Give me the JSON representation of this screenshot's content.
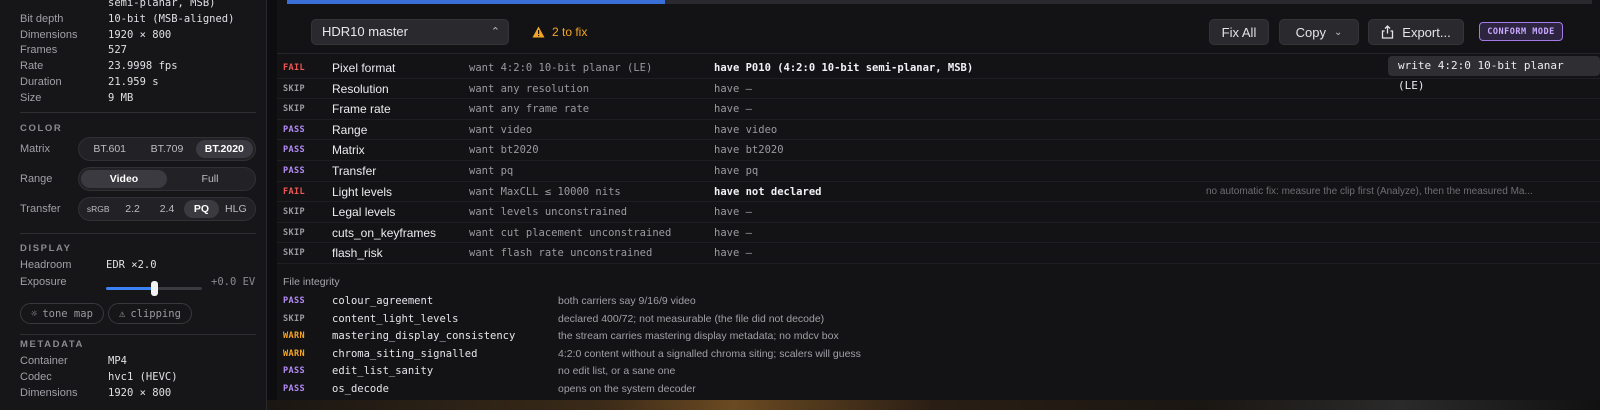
{
  "sidebar": {
    "file_info": [
      {
        "key": "",
        "value": "semi-planar, MSB)"
      },
      {
        "key": "Bit depth",
        "value": "10-bit (MSB-aligned)"
      },
      {
        "key": "Dimensions",
        "value": "1920 × 800"
      },
      {
        "key": "Frames",
        "value": "527"
      },
      {
        "key": "Rate",
        "value": "23.9998 fps"
      },
      {
        "key": "Duration",
        "value": "21.959 s"
      },
      {
        "key": "Size",
        "value": "9 MB"
      }
    ],
    "color": {
      "title": "COLOR",
      "matrix_label": "Matrix",
      "matrix_options": [
        "BT.601",
        "BT.709",
        "BT.2020"
      ],
      "matrix_selected": "BT.2020",
      "range_label": "Range",
      "range_options": [
        "Video",
        "Full"
      ],
      "range_selected": "Video",
      "transfer_label": "Transfer",
      "transfer_options": [
        "sRGB",
        "2.2",
        "2.4",
        "PQ",
        "HLG"
      ],
      "transfer_selected": "PQ"
    },
    "display": {
      "title": "DISPLAY",
      "headroom_label": "Headroom",
      "headroom_value": "EDR ×2.0",
      "exposure_label": "Exposure",
      "exposure_value": "+0.0 EV",
      "exposure_fraction": 0.5,
      "tone_map_label": "tone map",
      "clipping_label": "clipping"
    },
    "metadata": {
      "title": "METADATA",
      "items": [
        {
          "key": "Container",
          "value": "MP4"
        },
        {
          "key": "Codec",
          "value": "hvc1 (HEVC)"
        },
        {
          "key": "Dimensions",
          "value": "1920 × 800"
        }
      ]
    }
  },
  "toolbar": {
    "preset": "HDR10 master",
    "fix_count": "2 to fix",
    "fix_all": "Fix All",
    "copy": "Copy",
    "export": "Export...",
    "mode_badge": "CONFORM MODE",
    "progress_fraction": 0.29
  },
  "checks": [
    {
      "status": "FAIL",
      "name": "Pixel format",
      "want": "want 4:2:0 10-bit planar (LE)",
      "have": "have P010 (4:2:0 10-bit semi-planar, MSB)",
      "have_bold": true,
      "note": "",
      "action": "write 4:2:0 10-bit planar (LE)"
    },
    {
      "status": "SKIP",
      "name": "Resolution",
      "want": "want any resolution",
      "have": "have —",
      "have_bold": false,
      "note": "",
      "action": ""
    },
    {
      "status": "SKIP",
      "name": "Frame rate",
      "want": "want any frame rate",
      "have": "have —",
      "have_bold": false,
      "note": "",
      "action": ""
    },
    {
      "status": "PASS",
      "name": "Range",
      "want": "want video",
      "have": "have video",
      "have_bold": false,
      "note": "",
      "action": ""
    },
    {
      "status": "PASS",
      "name": "Matrix",
      "want": "want bt2020",
      "have": "have bt2020",
      "have_bold": false,
      "note": "",
      "action": ""
    },
    {
      "status": "PASS",
      "name": "Transfer",
      "want": "want pq",
      "have": "have pq",
      "have_bold": false,
      "note": "",
      "action": ""
    },
    {
      "status": "FAIL",
      "name": "Light levels",
      "want": "want MaxCLL ≤ 10000 nits",
      "have": "have not declared",
      "have_bold": true,
      "note": "no automatic fix: measure the clip first (Analyze), then the measured Ma...",
      "action": ""
    },
    {
      "status": "SKIP",
      "name": "Legal levels",
      "want": "want levels unconstrained",
      "have": "have —",
      "have_bold": false,
      "note": "",
      "action": ""
    },
    {
      "status": "SKIP",
      "name": "cuts_on_keyframes",
      "want": "want cut placement unconstrained",
      "have": "have —",
      "have_bold": false,
      "note": "",
      "action": ""
    },
    {
      "status": "SKIP",
      "name": "flash_risk",
      "want": "want flash rate unconstrained",
      "have": "have —",
      "have_bold": false,
      "note": "",
      "action": ""
    }
  ],
  "integrity": {
    "title": "File integrity",
    "items": [
      {
        "status": "PASS",
        "name": "colour_agreement",
        "desc": "both carriers say 9/16/9 video"
      },
      {
        "status": "SKIP",
        "name": "content_light_levels",
        "desc": "declared 400/72; not measurable (the file did not decode)"
      },
      {
        "status": "WARN",
        "name": "mastering_display_consistency",
        "desc": "the stream carries mastering display metadata; no mdcv box"
      },
      {
        "status": "WARN",
        "name": "chroma_siting_signalled",
        "desc": "4:2:0 content without a signalled chroma siting; scalers will guess"
      },
      {
        "status": "PASS",
        "name": "edit_list_sanity",
        "desc": "no edit list, or a sane one"
      },
      {
        "status": "PASS",
        "name": "os_decode",
        "desc": "opens on the system decoder"
      }
    ]
  }
}
